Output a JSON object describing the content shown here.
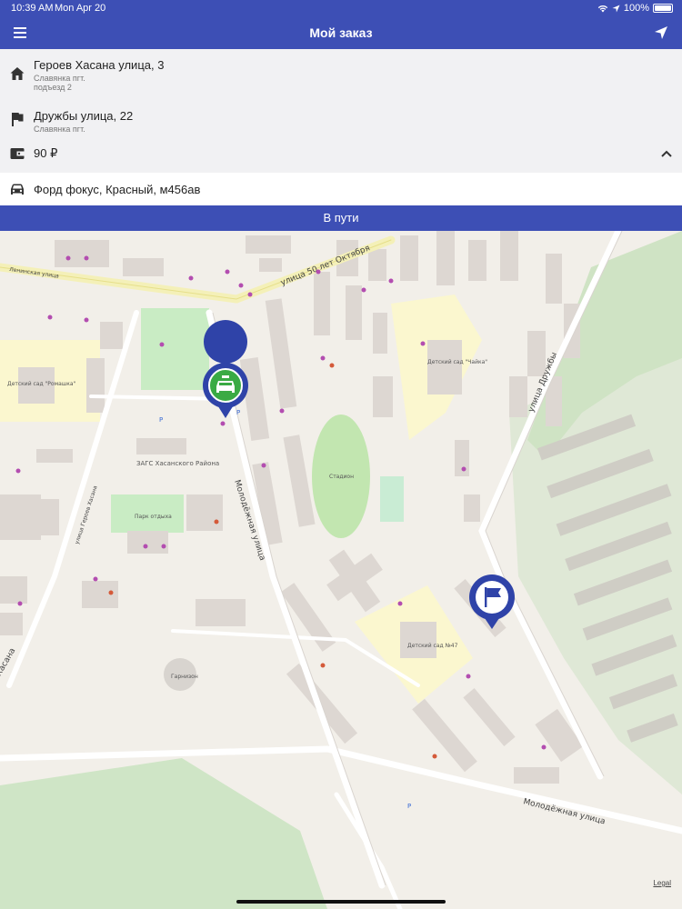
{
  "status_bar": {
    "time": "10:39 AM",
    "date": "Mon Apr 20",
    "battery": "100%"
  },
  "header": {
    "title": "Мой заказ"
  },
  "order": {
    "from": {
      "street": "Героев Хасана улица, 3",
      "city": "Славянка пгт.",
      "entrance": "подъезд 2"
    },
    "to": {
      "street": "Дружбы улица, 22",
      "city": "Славянка пгт."
    },
    "price": "90 ₽",
    "car": "Форд фокус, Красный, м456ав"
  },
  "status_button": {
    "label": "В пути"
  },
  "map": {
    "streets": {
      "s1": "улица 50 лет Октября",
      "s2": "Ленинская улица",
      "s3": "Молодёжная улица",
      "s4": "улица Дружбы",
      "s5": "Молодёжная улица",
      "s6": "улица Героев Хасана",
      "s7": "Хасана"
    },
    "places": {
      "p1": "Детский сад \"Ромашка\"",
      "p2": "ЗАГС Хасанского Района",
      "p3": "Парк отдыха",
      "p4": "Стадион",
      "p5": "Детский сад №47",
      "p6": "Детский сад \"Чайка\"",
      "p7": "Гарнизон"
    },
    "legal": "Legal",
    "taxi_marker_color": "#3aaa44",
    "pin_color": "#2f43a8"
  }
}
